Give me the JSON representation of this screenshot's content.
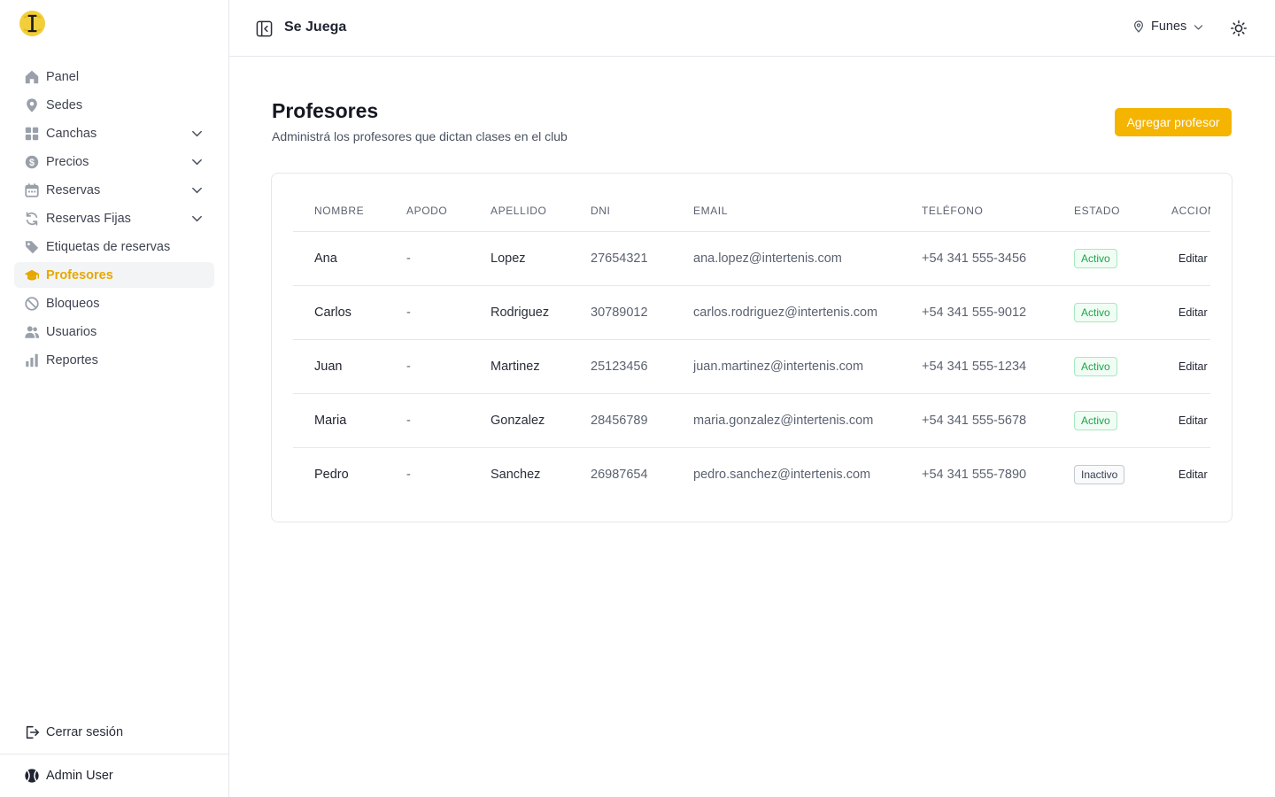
{
  "app": {
    "title": "Se Juega"
  },
  "header": {
    "location": "Funes"
  },
  "sidebar": {
    "items": [
      {
        "label": "Panel",
        "icon": "home-icon",
        "expandable": false,
        "active": false
      },
      {
        "label": "Sedes",
        "icon": "map-pin-icon",
        "expandable": false,
        "active": false
      },
      {
        "label": "Canchas",
        "icon": "grid-icon",
        "expandable": true,
        "active": false
      },
      {
        "label": "Precios",
        "icon": "dollar-icon",
        "expandable": true,
        "active": false
      },
      {
        "label": "Reservas",
        "icon": "calendar-icon",
        "expandable": true,
        "active": false
      },
      {
        "label": "Reservas Fijas",
        "icon": "refresh-icon",
        "expandable": true,
        "active": false
      },
      {
        "label": "Etiquetas de reservas",
        "icon": "tag-icon",
        "expandable": false,
        "active": false
      },
      {
        "label": "Profesores",
        "icon": "graduation-cap-icon",
        "expandable": false,
        "active": true
      },
      {
        "label": "Bloqueos",
        "icon": "ban-icon",
        "expandable": false,
        "active": false
      },
      {
        "label": "Usuarios",
        "icon": "users-icon",
        "expandable": false,
        "active": false
      },
      {
        "label": "Reportes",
        "icon": "bar-chart-icon",
        "expandable": false,
        "active": false
      }
    ],
    "logout_label": "Cerrar sesión",
    "user_name": "Admin User"
  },
  "page": {
    "title": "Profesores",
    "subtitle": "Administrá los profesores que dictan clases en el club",
    "add_button": "Agregar profesor"
  },
  "table": {
    "columns": [
      "NOMBRE",
      "APODO",
      "APELLIDO",
      "DNI",
      "EMAIL",
      "TELÉFONO",
      "ESTADO",
      "ACCIONES"
    ],
    "rows": [
      {
        "nombre": "Ana",
        "apodo": "-",
        "apellido": "Lopez",
        "dni": "27654321",
        "email": "ana.lopez@intertenis.com",
        "telefono": "+54 341 555-3456",
        "estado": "Activo",
        "activo": true,
        "accion": "Editar"
      },
      {
        "nombre": "Carlos",
        "apodo": "-",
        "apellido": "Rodriguez",
        "dni": "30789012",
        "email": "carlos.rodriguez@intertenis.com",
        "telefono": "+54 341 555-9012",
        "estado": "Activo",
        "activo": true,
        "accion": "Editar"
      },
      {
        "nombre": "Juan",
        "apodo": "-",
        "apellido": "Martinez",
        "dni": "25123456",
        "email": "juan.martinez@intertenis.com",
        "telefono": "+54 341 555-1234",
        "estado": "Activo",
        "activo": true,
        "accion": "Editar"
      },
      {
        "nombre": "Maria",
        "apodo": "-",
        "apellido": "Gonzalez",
        "dni": "28456789",
        "email": "maria.gonzalez@intertenis.com",
        "telefono": "+54 341 555-5678",
        "estado": "Activo",
        "activo": true,
        "accion": "Editar"
      },
      {
        "nombre": "Pedro",
        "apodo": "-",
        "apellido": "Sanchez",
        "dni": "26987654",
        "email": "pedro.sanchez@intertenis.com",
        "telefono": "+54 341 555-7890",
        "estado": "Inactivo",
        "activo": false,
        "accion": "Editar"
      }
    ]
  },
  "colors": {
    "accent": "#f4b400",
    "active_nav": "#e6a800",
    "badge_active": "#1fa34a"
  }
}
